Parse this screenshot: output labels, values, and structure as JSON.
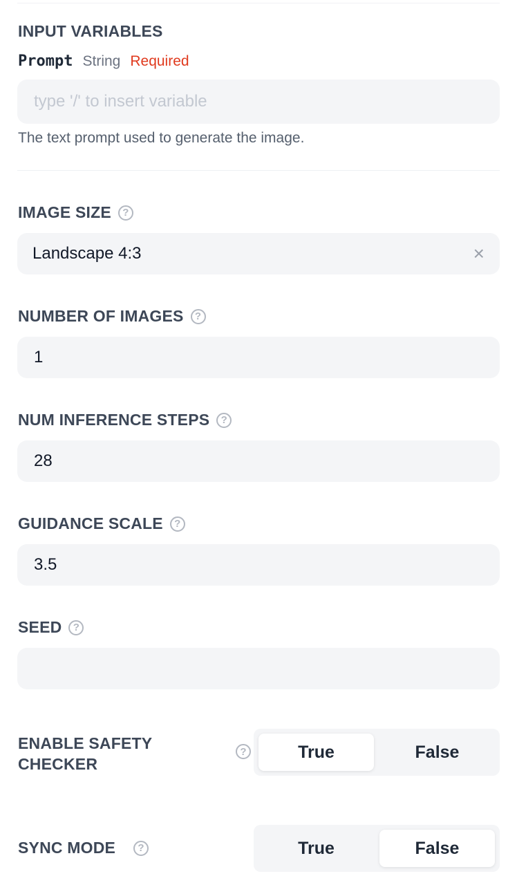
{
  "section_title": "INPUT VARIABLES",
  "prompt": {
    "name": "Prompt",
    "type": "String",
    "required": "Required",
    "placeholder": "type '/' to insert variable",
    "description": "The text prompt used to generate the image."
  },
  "image_size": {
    "label": "IMAGE SIZE",
    "value": "Landscape 4:3",
    "clear_icon": "×"
  },
  "num_images": {
    "label": "NUMBER OF IMAGES",
    "value": "1"
  },
  "num_inference_steps": {
    "label": "NUM INFERENCE STEPS",
    "value": "28"
  },
  "guidance_scale": {
    "label": "GUIDANCE SCALE",
    "value": "3.5"
  },
  "seed": {
    "label": "SEED",
    "value": ""
  },
  "safety_checker": {
    "label_line1": "ENABLE SAFETY",
    "label_line2": "CHECKER",
    "true_label": "True",
    "false_label": "False",
    "selected": "True"
  },
  "sync_mode": {
    "label": "SYNC MODE",
    "true_label": "True",
    "false_label": "False",
    "selected": "False"
  },
  "help_icon_glyph": "?",
  "colors": {
    "required": "#e03a1e",
    "label": "#3d4757",
    "field_bg": "#f4f5f7"
  }
}
